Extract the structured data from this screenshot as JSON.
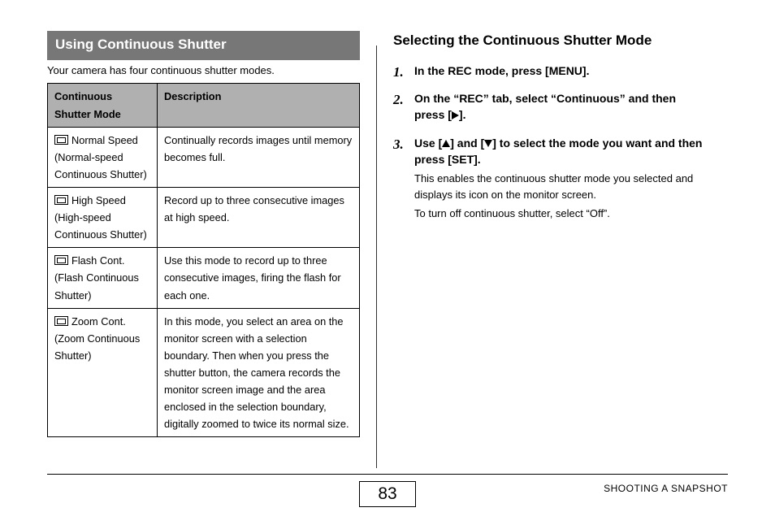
{
  "left": {
    "section_title": "Using Continuous Shutter",
    "intro": "Your camera has four continuous shutter modes.",
    "table": {
      "head_mode": "Continuous Shutter Mode",
      "head_desc": "Description",
      "rows": [
        {
          "name": "Normal Speed",
          "sub": "(Normal-speed Continuous Shutter)",
          "desc": "Continually records images until memory becomes full."
        },
        {
          "name": "High Speed",
          "sub": "(High-speed Continuous Shutter)",
          "desc": "Record up to three consecutive images at high speed."
        },
        {
          "name": "Flash Cont.",
          "sub": "(Flash Continuous Shutter)",
          "desc": "Use this mode to record up to three consecutive images, firing the flash for each one."
        },
        {
          "name": "Zoom Cont.",
          "sub": "(Zoom Continuous Shutter)",
          "desc": "In this mode, you select an area on the monitor screen with a selection boundary. Then when you press the shutter button, the camera records the monitor screen image and the area enclosed in the selection boundary, digitally zoomed to twice its normal size."
        }
      ]
    }
  },
  "right": {
    "heading": "Selecting the Continuous Shutter Mode",
    "steps": {
      "s1": "In the REC mode, press [MENU].",
      "s2a": "On the “REC” tab, select “Continuous” and then press [",
      "s2b": "].",
      "s3a": "Use [",
      "s3b": "] and [",
      "s3c": "] to select the mode you want and then press [SET].",
      "s3_sub1": "This enables the continuous shutter mode you selected and displays its icon on the monitor screen.",
      "s3_sub2": "To turn off continuous shutter, select “Off”."
    }
  },
  "footer": {
    "page": "83",
    "label": "SHOOTING A SNAPSHOT"
  }
}
